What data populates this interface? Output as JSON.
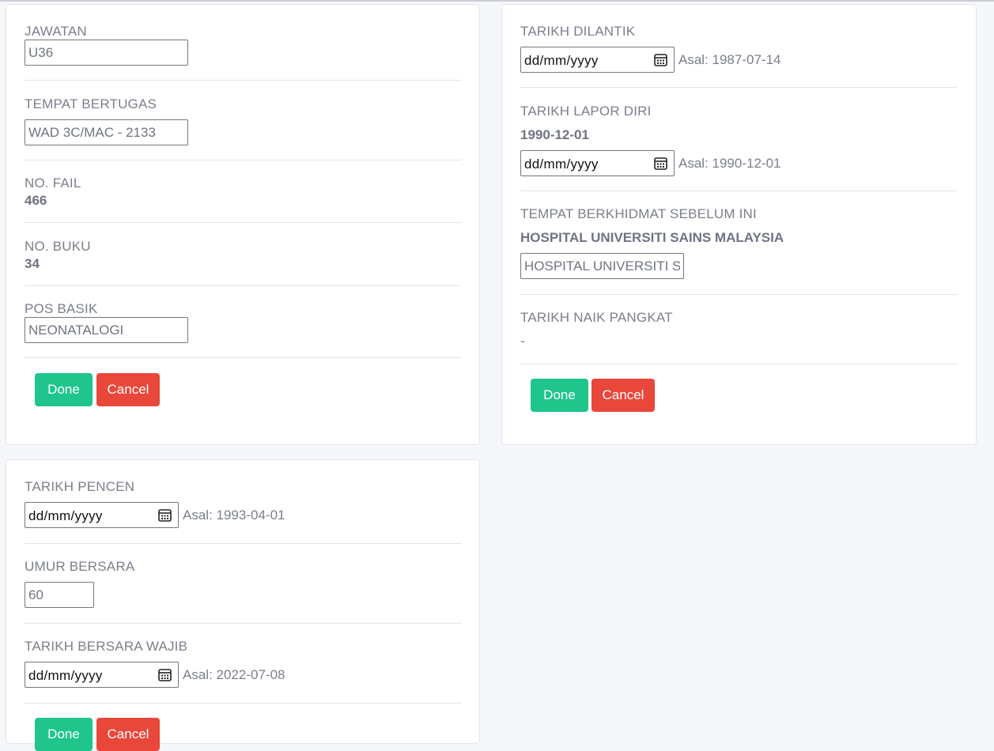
{
  "card_a": {
    "jawatan_label": "JAWATAN",
    "jawatan_value": "U36",
    "tempat_bertugas_label": "TEMPAT BERTUGAS",
    "tempat_bertugas_value": "WAD 3C/MAC - 2133",
    "no_fail_label": "NO. FAIL",
    "no_fail_value": "466",
    "no_buku_label": "NO. BUKU",
    "no_buku_value": "34",
    "pos_basik_label": "POS BASIK",
    "pos_basik_value": "NEONATALOGI",
    "done_label": "Done",
    "cancel_label": "Cancel"
  },
  "card_b": {
    "tarikh_dilantik_label": "TARIKH DILANTIK",
    "tarikh_dilantik_placeholder": "dd/mm/yyyy",
    "tarikh_dilantik_asal": "Asal: 1987-07-14",
    "tarikh_lapor_diri_label": "TARIKH LAPOR DIRI",
    "tarikh_lapor_diri_value": "1990-12-01",
    "tarikh_lapor_diri_placeholder": "dd/mm/yyyy",
    "tarikh_lapor_diri_asal": "Asal: 1990-12-01",
    "tempat_sebelum_label": "TEMPAT BERKHIDMAT SEBELUM INI",
    "tempat_sebelum_value": "HOSPITAL UNIVERSITI SAINS MALAYSIA",
    "tempat_sebelum_input": "HOSPITAL UNIVERSITI SAINS MALAYSIA",
    "tarikh_naik_pangkat_label": "TARIKH NAIK PANGKAT",
    "tarikh_naik_pangkat_value": "-",
    "done_label": "Done",
    "cancel_label": "Cancel"
  },
  "card_c": {
    "tarikh_pencen_label": "TARIKH PENCEN",
    "tarikh_pencen_placeholder": "dd/mm/yyyy",
    "tarikh_pencen_asal": "Asal: 1993-04-01",
    "umur_bersara_label": "UMUR BERSARA",
    "umur_bersara_value": "60",
    "tarikh_bersara_wajib_label": "TARIKH BERSARA WAJIB",
    "tarikh_bersara_wajib_placeholder": "dd/mm/yyyy",
    "tarikh_bersara_wajib_asal": "Asal: 2022-07-08",
    "done_label": "Done",
    "cancel_label": "Cancel"
  },
  "icons": {
    "calendar": "calendar-icon"
  },
  "colors": {
    "done": "#20c58b",
    "cancel": "#e8473a",
    "page_bg": "#f6f7fb"
  }
}
